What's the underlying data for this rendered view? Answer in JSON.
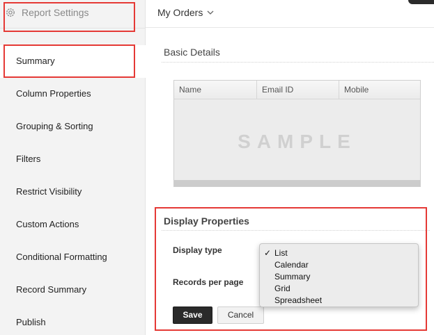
{
  "sidebar": {
    "title": "Report Settings",
    "items": [
      {
        "label": "Summary",
        "active": true
      },
      {
        "label": "Column Properties"
      },
      {
        "label": "Grouping & Sorting"
      },
      {
        "label": "Filters"
      },
      {
        "label": "Restrict Visibility"
      },
      {
        "label": "Custom Actions"
      },
      {
        "label": "Conditional Formatting"
      },
      {
        "label": "Record Summary"
      },
      {
        "label": "Publish"
      }
    ]
  },
  "topbar": {
    "report_name": "My Orders",
    "dropdown_icon": "chevron-down-icon"
  },
  "basic_details": {
    "title": "Basic Details",
    "columns": [
      "Name",
      "Email ID",
      "Mobile"
    ],
    "watermark": "SAMPLE"
  },
  "display_properties": {
    "title": "Display Properties",
    "display_type_label": "Display type",
    "records_per_page_label": "Records per page",
    "display_type_options": [
      "List",
      "Calendar",
      "Summary",
      "Grid",
      "Spreadsheet"
    ],
    "selected_display_type": "List",
    "check_mark": "✓",
    "save_label": "Save",
    "cancel_label": "Cancel"
  },
  "colors": {
    "highlight": "#e53935",
    "sidebar_bg": "#f3f3f3",
    "save_bg": "#2a2a2a"
  }
}
